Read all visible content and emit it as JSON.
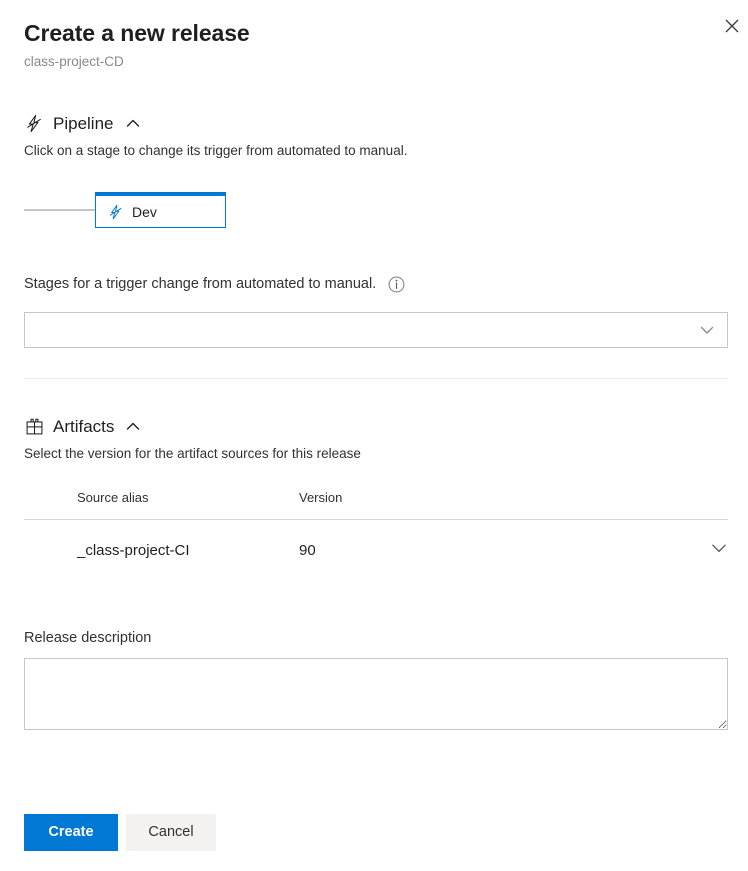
{
  "dialog": {
    "title": "Create a new release",
    "subtitle": "class-project-CD",
    "close_icon": "close-icon"
  },
  "pipeline": {
    "icon": "release-lightning-icon",
    "title": "Pipeline",
    "collapse_icon": "chevron-up-icon",
    "description": "Click on a stage to change its trigger from automated to manual.",
    "stages": [
      {
        "name": "Dev",
        "icon": "stage-lightning-icon"
      }
    ]
  },
  "trigger": {
    "label": "Stages for a trigger change from automated to manual.",
    "info_icon": "info-circle-icon",
    "dropdown_value": "",
    "dropdown_placeholder": "",
    "dropdown_icon": "chevron-down-icon"
  },
  "artifacts": {
    "icon": "gift-box-icon",
    "title": "Artifacts",
    "collapse_icon": "chevron-up-icon",
    "description": "Select the version for the artifact sources for this release",
    "columns": [
      "Source alias",
      "Version"
    ],
    "rows": [
      {
        "source_alias": "_class-project-CI",
        "version": "90",
        "expand_icon": "chevron-down-icon"
      }
    ]
  },
  "release_description": {
    "label": "Release description",
    "value": "",
    "placeholder": ""
  },
  "footer": {
    "create_label": "Create",
    "cancel_label": "Cancel"
  },
  "colors": {
    "accent": "#0078d4",
    "text": "#1f1f1f",
    "muted": "#8a8886",
    "border": "#c8c6c4",
    "secondary_button": "#f3f2f1"
  }
}
